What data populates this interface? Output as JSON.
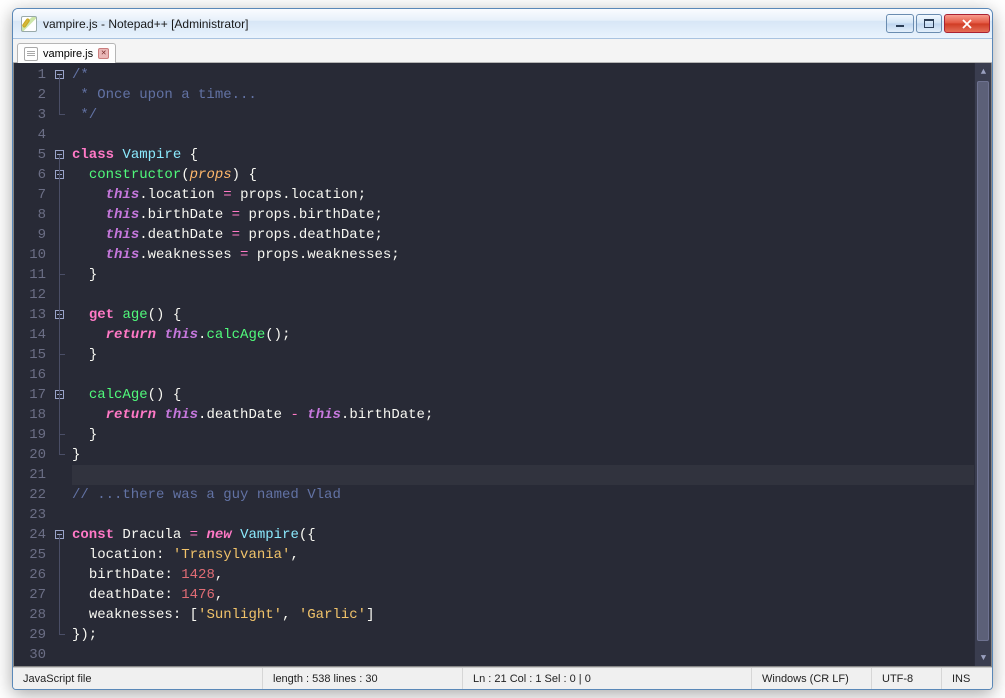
{
  "window": {
    "title": "vampire.js - Notepad++ [Administrator]"
  },
  "tab": {
    "label": "vampire.js"
  },
  "lineCount": 30,
  "currentLine": 21,
  "code": [
    [
      {
        "t": "/*",
        "c": "c-cmt"
      }
    ],
    [
      {
        "t": " * Once upon a time...",
        "c": "c-cmt"
      }
    ],
    [
      {
        "t": " */",
        "c": "c-cmt"
      }
    ],
    [],
    [
      {
        "t": "class",
        "c": "c-kw"
      },
      {
        "t": " "
      },
      {
        "t": "Vampire",
        "c": "c-cls"
      },
      {
        "t": " "
      },
      {
        "t": "{",
        "c": "c-br"
      }
    ],
    [
      {
        "t": "  "
      },
      {
        "t": "constructor",
        "c": "c-fn"
      },
      {
        "t": "("
      },
      {
        "t": "props",
        "c": "c-prm"
      },
      {
        "t": ") "
      },
      {
        "t": "{",
        "c": "c-br"
      }
    ],
    [
      {
        "t": "    "
      },
      {
        "t": "this",
        "c": "c-th"
      },
      {
        "t": "."
      },
      {
        "t": "location",
        "c": "c-id"
      },
      {
        "t": " "
      },
      {
        "t": "=",
        "c": "c-op"
      },
      {
        "t": " "
      },
      {
        "t": "props",
        "c": "c-id"
      },
      {
        "t": "."
      },
      {
        "t": "location",
        "c": "c-id"
      },
      {
        "t": ";"
      }
    ],
    [
      {
        "t": "    "
      },
      {
        "t": "this",
        "c": "c-th"
      },
      {
        "t": "."
      },
      {
        "t": "birthDate",
        "c": "c-id"
      },
      {
        "t": " "
      },
      {
        "t": "=",
        "c": "c-op"
      },
      {
        "t": " "
      },
      {
        "t": "props",
        "c": "c-id"
      },
      {
        "t": "."
      },
      {
        "t": "birthDate",
        "c": "c-id"
      },
      {
        "t": ";"
      }
    ],
    [
      {
        "t": "    "
      },
      {
        "t": "this",
        "c": "c-th"
      },
      {
        "t": "."
      },
      {
        "t": "deathDate",
        "c": "c-id"
      },
      {
        "t": " "
      },
      {
        "t": "=",
        "c": "c-op"
      },
      {
        "t": " "
      },
      {
        "t": "props",
        "c": "c-id"
      },
      {
        "t": "."
      },
      {
        "t": "deathDate",
        "c": "c-id"
      },
      {
        "t": ";"
      }
    ],
    [
      {
        "t": "    "
      },
      {
        "t": "this",
        "c": "c-th"
      },
      {
        "t": "."
      },
      {
        "t": "weaknesses",
        "c": "c-id"
      },
      {
        "t": " "
      },
      {
        "t": "=",
        "c": "c-op"
      },
      {
        "t": " "
      },
      {
        "t": "props",
        "c": "c-id"
      },
      {
        "t": "."
      },
      {
        "t": "weaknesses",
        "c": "c-id"
      },
      {
        "t": ";"
      }
    ],
    [
      {
        "t": "  "
      },
      {
        "t": "}",
        "c": "c-br"
      }
    ],
    [],
    [
      {
        "t": "  "
      },
      {
        "t": "get",
        "c": "c-kw"
      },
      {
        "t": " "
      },
      {
        "t": "age",
        "c": "c-fn"
      },
      {
        "t": "() "
      },
      {
        "t": "{",
        "c": "c-br"
      }
    ],
    [
      {
        "t": "    "
      },
      {
        "t": "return",
        "c": "c-kwi"
      },
      {
        "t": " "
      },
      {
        "t": "this",
        "c": "c-th"
      },
      {
        "t": "."
      },
      {
        "t": "calcAge",
        "c": "c-fn"
      },
      {
        "t": "();"
      }
    ],
    [
      {
        "t": "  "
      },
      {
        "t": "}",
        "c": "c-br"
      }
    ],
    [],
    [
      {
        "t": "  "
      },
      {
        "t": "calcAge",
        "c": "c-fn"
      },
      {
        "t": "() "
      },
      {
        "t": "{",
        "c": "c-br"
      }
    ],
    [
      {
        "t": "    "
      },
      {
        "t": "return",
        "c": "c-kwi"
      },
      {
        "t": " "
      },
      {
        "t": "this",
        "c": "c-th"
      },
      {
        "t": "."
      },
      {
        "t": "deathDate",
        "c": "c-id"
      },
      {
        "t": " "
      },
      {
        "t": "-",
        "c": "c-op"
      },
      {
        "t": " "
      },
      {
        "t": "this",
        "c": "c-th"
      },
      {
        "t": "."
      },
      {
        "t": "birthDate",
        "c": "c-id"
      },
      {
        "t": ";"
      }
    ],
    [
      {
        "t": "  "
      },
      {
        "t": "}",
        "c": "c-br"
      }
    ],
    [
      {
        "t": "}",
        "c": "c-br"
      }
    ],
    [],
    [
      {
        "t": "// ...there was a guy named Vlad",
        "c": "c-cmt"
      }
    ],
    [],
    [
      {
        "t": "const",
        "c": "c-kw"
      },
      {
        "t": " "
      },
      {
        "t": "Dracula",
        "c": "c-id"
      },
      {
        "t": " "
      },
      {
        "t": "=",
        "c": "c-op"
      },
      {
        "t": " "
      },
      {
        "t": "new",
        "c": "c-kwi"
      },
      {
        "t": " "
      },
      {
        "t": "Vampire",
        "c": "c-cls"
      },
      {
        "t": "({"
      }
    ],
    [
      {
        "t": "  "
      },
      {
        "t": "location",
        "c": "c-id"
      },
      {
        "t": ": "
      },
      {
        "t": "'Transylvania'",
        "c": "c-str"
      },
      {
        "t": ","
      }
    ],
    [
      {
        "t": "  "
      },
      {
        "t": "birthDate",
        "c": "c-id"
      },
      {
        "t": ": "
      },
      {
        "t": "1428",
        "c": "c-num"
      },
      {
        "t": ","
      }
    ],
    [
      {
        "t": "  "
      },
      {
        "t": "deathDate",
        "c": "c-id"
      },
      {
        "t": ": "
      },
      {
        "t": "1476",
        "c": "c-num"
      },
      {
        "t": ","
      }
    ],
    [
      {
        "t": "  "
      },
      {
        "t": "weaknesses",
        "c": "c-id"
      },
      {
        "t": ": ["
      },
      {
        "t": "'Sunlight'",
        "c": "c-str"
      },
      {
        "t": ", "
      },
      {
        "t": "'Garlic'",
        "c": "c-str"
      },
      {
        "t": "]"
      }
    ],
    [
      {
        "t": "});"
      }
    ],
    []
  ],
  "fold": [
    "box",
    "line",
    "corner",
    "",
    "box",
    "box",
    "line",
    "line",
    "line",
    "line",
    "corner",
    "line",
    "box",
    "line",
    "corner",
    "line",
    "box",
    "line",
    "corner",
    "corner",
    "",
    "",
    "",
    "box",
    "line",
    "line",
    "line",
    "line",
    "corner",
    ""
  ],
  "status": {
    "lang": "JavaScript file",
    "length": "length : 538    lines : 30",
    "pos": "Ln : 21    Col : 1    Sel : 0 | 0",
    "eol": "Windows (CR LF)",
    "enc": "UTF-8",
    "ins": "INS"
  }
}
